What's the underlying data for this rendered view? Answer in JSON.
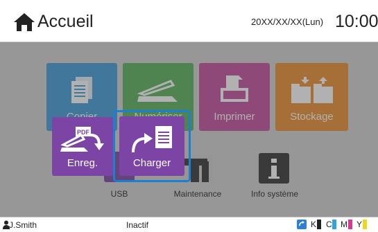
{
  "header": {
    "title": "Accueil",
    "date": "20XX/XX/XX(Lun)",
    "time": "10:00"
  },
  "tiles": [
    {
      "id": "copier",
      "label": "Copier",
      "color": "#3e9bd8"
    },
    {
      "id": "numeriser",
      "label": "Numériser",
      "color": "#56b25a"
    },
    {
      "id": "imprimer",
      "label": "Imprimer",
      "color": "#c34c9e"
    },
    {
      "id": "stockage",
      "label": "Stockage",
      "color": "#ea8d2e"
    }
  ],
  "bottom_items": [
    {
      "label": "USB"
    },
    {
      "label": "Maintenance"
    },
    {
      "label": "Info système"
    }
  ],
  "popup": {
    "enreg_label": "Enreg.",
    "charger_label": "Charger",
    "pdf_badge": "PDF",
    "color": "#7b44a5",
    "highlight_color": "#1c7fd0"
  },
  "status_bar": {
    "user": "J.Smith",
    "status": "Inactif",
    "inks": [
      "K",
      "C",
      "M",
      "Y"
    ],
    "ink_colors": [
      "#222222",
      "#2aa6e0",
      "#d23c93",
      "#f2d41b"
    ]
  }
}
